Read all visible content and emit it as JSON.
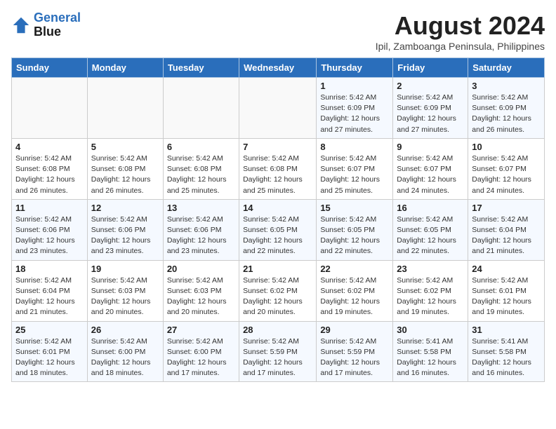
{
  "header": {
    "logo_line1": "General",
    "logo_line2": "Blue",
    "month_year": "August 2024",
    "location": "Ipil, Zamboanga Peninsula, Philippines"
  },
  "weekdays": [
    "Sunday",
    "Monday",
    "Tuesday",
    "Wednesday",
    "Thursday",
    "Friday",
    "Saturday"
  ],
  "weeks": [
    [
      {
        "day": "",
        "info": ""
      },
      {
        "day": "",
        "info": ""
      },
      {
        "day": "",
        "info": ""
      },
      {
        "day": "",
        "info": ""
      },
      {
        "day": "1",
        "info": "Sunrise: 5:42 AM\nSunset: 6:09 PM\nDaylight: 12 hours\nand 27 minutes."
      },
      {
        "day": "2",
        "info": "Sunrise: 5:42 AM\nSunset: 6:09 PM\nDaylight: 12 hours\nand 27 minutes."
      },
      {
        "day": "3",
        "info": "Sunrise: 5:42 AM\nSunset: 6:09 PM\nDaylight: 12 hours\nand 26 minutes."
      }
    ],
    [
      {
        "day": "4",
        "info": "Sunrise: 5:42 AM\nSunset: 6:08 PM\nDaylight: 12 hours\nand 26 minutes."
      },
      {
        "day": "5",
        "info": "Sunrise: 5:42 AM\nSunset: 6:08 PM\nDaylight: 12 hours\nand 26 minutes."
      },
      {
        "day": "6",
        "info": "Sunrise: 5:42 AM\nSunset: 6:08 PM\nDaylight: 12 hours\nand 25 minutes."
      },
      {
        "day": "7",
        "info": "Sunrise: 5:42 AM\nSunset: 6:08 PM\nDaylight: 12 hours\nand 25 minutes."
      },
      {
        "day": "8",
        "info": "Sunrise: 5:42 AM\nSunset: 6:07 PM\nDaylight: 12 hours\nand 25 minutes."
      },
      {
        "day": "9",
        "info": "Sunrise: 5:42 AM\nSunset: 6:07 PM\nDaylight: 12 hours\nand 24 minutes."
      },
      {
        "day": "10",
        "info": "Sunrise: 5:42 AM\nSunset: 6:07 PM\nDaylight: 12 hours\nand 24 minutes."
      }
    ],
    [
      {
        "day": "11",
        "info": "Sunrise: 5:42 AM\nSunset: 6:06 PM\nDaylight: 12 hours\nand 23 minutes."
      },
      {
        "day": "12",
        "info": "Sunrise: 5:42 AM\nSunset: 6:06 PM\nDaylight: 12 hours\nand 23 minutes."
      },
      {
        "day": "13",
        "info": "Sunrise: 5:42 AM\nSunset: 6:06 PM\nDaylight: 12 hours\nand 23 minutes."
      },
      {
        "day": "14",
        "info": "Sunrise: 5:42 AM\nSunset: 6:05 PM\nDaylight: 12 hours\nand 22 minutes."
      },
      {
        "day": "15",
        "info": "Sunrise: 5:42 AM\nSunset: 6:05 PM\nDaylight: 12 hours\nand 22 minutes."
      },
      {
        "day": "16",
        "info": "Sunrise: 5:42 AM\nSunset: 6:05 PM\nDaylight: 12 hours\nand 22 minutes."
      },
      {
        "day": "17",
        "info": "Sunrise: 5:42 AM\nSunset: 6:04 PM\nDaylight: 12 hours\nand 21 minutes."
      }
    ],
    [
      {
        "day": "18",
        "info": "Sunrise: 5:42 AM\nSunset: 6:04 PM\nDaylight: 12 hours\nand 21 minutes."
      },
      {
        "day": "19",
        "info": "Sunrise: 5:42 AM\nSunset: 6:03 PM\nDaylight: 12 hours\nand 20 minutes."
      },
      {
        "day": "20",
        "info": "Sunrise: 5:42 AM\nSunset: 6:03 PM\nDaylight: 12 hours\nand 20 minutes."
      },
      {
        "day": "21",
        "info": "Sunrise: 5:42 AM\nSunset: 6:02 PM\nDaylight: 12 hours\nand 20 minutes."
      },
      {
        "day": "22",
        "info": "Sunrise: 5:42 AM\nSunset: 6:02 PM\nDaylight: 12 hours\nand 19 minutes."
      },
      {
        "day": "23",
        "info": "Sunrise: 5:42 AM\nSunset: 6:02 PM\nDaylight: 12 hours\nand 19 minutes."
      },
      {
        "day": "24",
        "info": "Sunrise: 5:42 AM\nSunset: 6:01 PM\nDaylight: 12 hours\nand 19 minutes."
      }
    ],
    [
      {
        "day": "25",
        "info": "Sunrise: 5:42 AM\nSunset: 6:01 PM\nDaylight: 12 hours\nand 18 minutes."
      },
      {
        "day": "26",
        "info": "Sunrise: 5:42 AM\nSunset: 6:00 PM\nDaylight: 12 hours\nand 18 minutes."
      },
      {
        "day": "27",
        "info": "Sunrise: 5:42 AM\nSunset: 6:00 PM\nDaylight: 12 hours\nand 17 minutes."
      },
      {
        "day": "28",
        "info": "Sunrise: 5:42 AM\nSunset: 5:59 PM\nDaylight: 12 hours\nand 17 minutes."
      },
      {
        "day": "29",
        "info": "Sunrise: 5:42 AM\nSunset: 5:59 PM\nDaylight: 12 hours\nand 17 minutes."
      },
      {
        "day": "30",
        "info": "Sunrise: 5:41 AM\nSunset: 5:58 PM\nDaylight: 12 hours\nand 16 minutes."
      },
      {
        "day": "31",
        "info": "Sunrise: 5:41 AM\nSunset: 5:58 PM\nDaylight: 12 hours\nand 16 minutes."
      }
    ]
  ]
}
